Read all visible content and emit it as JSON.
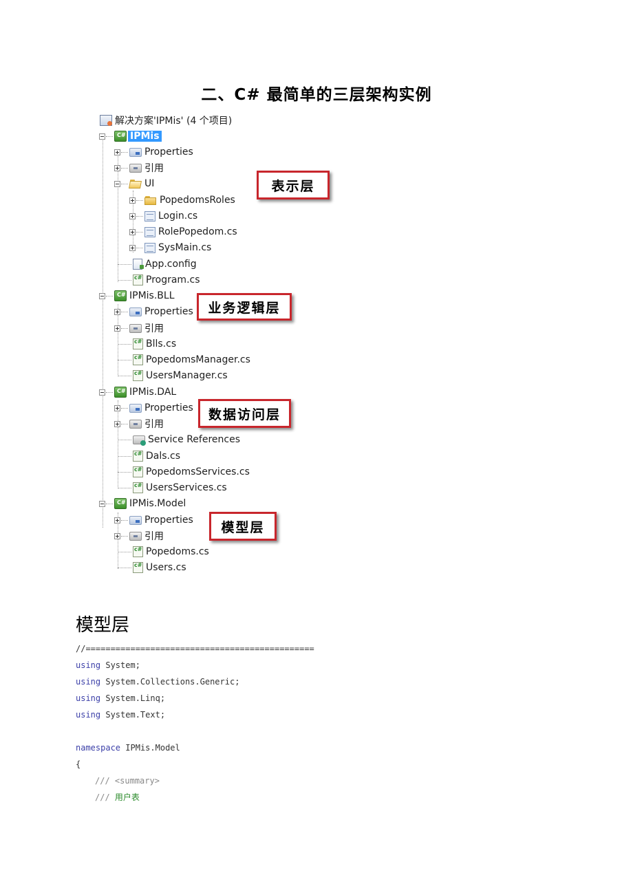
{
  "document": {
    "title": "二、C# 最简单的三层架构实例",
    "section_heading": "模型层"
  },
  "solution_tree": {
    "solution_label": "解决方案'IPMis' (4 个项目)",
    "projects": [
      {
        "name": "IPMis",
        "selected": true,
        "items": [
          {
            "label": "Properties",
            "icon": "properties-icon"
          },
          {
            "label": "引用",
            "icon": "references-icon"
          },
          {
            "label": "UI",
            "icon": "folder-open-icon",
            "children": [
              {
                "label": "PopedomsRoles",
                "icon": "folder-icon"
              },
              {
                "label": "Login.cs",
                "icon": "form-icon"
              },
              {
                "label": "RolePopedom.cs",
                "icon": "form-icon"
              },
              {
                "label": "SysMain.cs",
                "icon": "form-icon"
              }
            ]
          },
          {
            "label": "App.config",
            "icon": "config-file-icon"
          },
          {
            "label": "Program.cs",
            "icon": "csharp-file-icon"
          }
        ]
      },
      {
        "name": "IPMis.BLL",
        "items": [
          {
            "label": "Properties",
            "icon": "properties-icon"
          },
          {
            "label": "引用",
            "icon": "references-icon"
          },
          {
            "label": "Blls.cs",
            "icon": "csharp-file-icon"
          },
          {
            "label": "PopedomsManager.cs",
            "icon": "csharp-file-icon"
          },
          {
            "label": "UsersManager.cs",
            "icon": "csharp-file-icon"
          }
        ]
      },
      {
        "name": "IPMis.DAL",
        "items": [
          {
            "label": "Properties",
            "icon": "properties-icon"
          },
          {
            "label": "引用",
            "icon": "references-icon"
          },
          {
            "label": "Service References",
            "icon": "service-references-icon"
          },
          {
            "label": "Dals.cs",
            "icon": "csharp-file-icon"
          },
          {
            "label": "PopedomsServices.cs",
            "icon": "csharp-file-icon"
          },
          {
            "label": "UsersServices.cs",
            "icon": "csharp-file-icon"
          }
        ]
      },
      {
        "name": "IPMis.Model",
        "items": [
          {
            "label": "Properties",
            "icon": "properties-icon"
          },
          {
            "label": "引用",
            "icon": "references-icon"
          },
          {
            "label": "Popedoms.cs",
            "icon": "csharp-file-icon"
          },
          {
            "label": "Users.cs",
            "icon": "csharp-file-icon"
          }
        ]
      }
    ]
  },
  "callouts": {
    "ui_layer": "表示层",
    "bll_layer": "业务逻辑层",
    "dal_layer": "数据访问层",
    "model_layer": "模型层"
  },
  "code": {
    "separator": "//==============================================",
    "using_keyword": "using",
    "usings": [
      "System;",
      "System.Collections.Generic;",
      "System.Linq;",
      "System.Text;"
    ],
    "namespace_keyword": "namespace",
    "namespace_name": "IPMis.Model",
    "open_brace": "{",
    "comment_prefix": "///",
    "summary_tag": "<summary>",
    "summary_text": "用户表"
  },
  "colors": {
    "callout_border": "#c8262c",
    "keyword": "#3b3fa8",
    "selection": "#3399ff",
    "comment_text": "#2a8a2a"
  }
}
